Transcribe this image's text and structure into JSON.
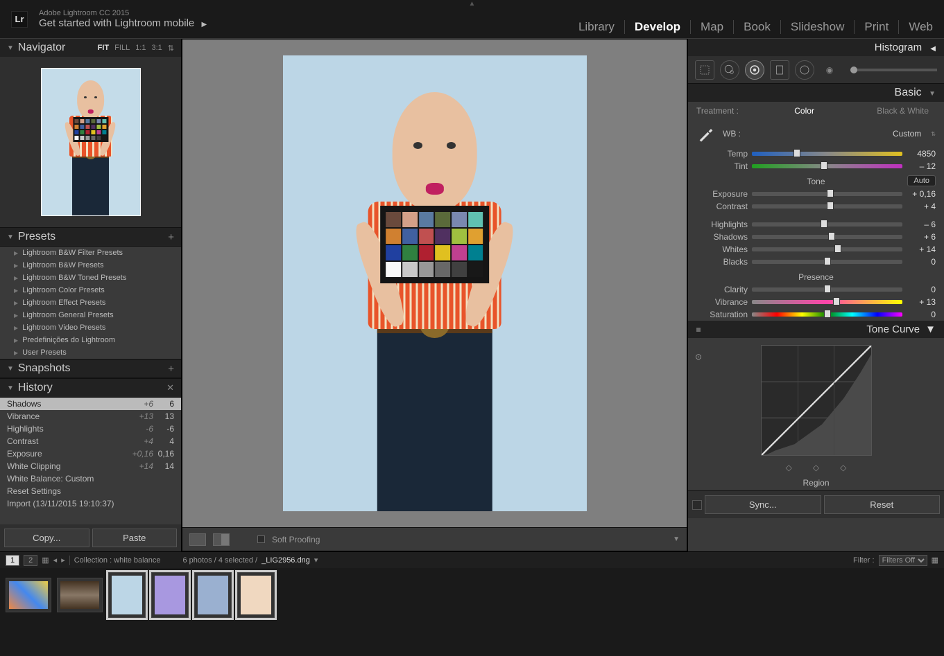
{
  "header": {
    "logo": "Lr",
    "app_title": "Adobe Lightroom CC 2015",
    "subtitle": "Get started with Lightroom mobile",
    "modules": [
      "Library",
      "Develop",
      "Map",
      "Book",
      "Slideshow",
      "Print",
      "Web"
    ],
    "active_module": "Develop"
  },
  "navigator": {
    "title": "Navigator",
    "zoom_levels": [
      "FIT",
      "FILL",
      "1:1",
      "3:1"
    ],
    "zoom_active": "FIT"
  },
  "presets": {
    "title": "Presets",
    "items": [
      "Lightroom B&W Filter Presets",
      "Lightroom B&W Presets",
      "Lightroom B&W Toned Presets",
      "Lightroom Color Presets",
      "Lightroom Effect Presets",
      "Lightroom General Presets",
      "Lightroom Video Presets",
      "Predefinições do Lightroom",
      "User Presets"
    ]
  },
  "snapshots": {
    "title": "Snapshots"
  },
  "history": {
    "title": "History",
    "items": [
      {
        "name": "Shadows",
        "delta": "+6",
        "val": "6",
        "sel": true
      },
      {
        "name": "Vibrance",
        "delta": "+13",
        "val": "13"
      },
      {
        "name": "Highlights",
        "delta": "-6",
        "val": "-6"
      },
      {
        "name": "Contrast",
        "delta": "+4",
        "val": "4"
      },
      {
        "name": "Exposure",
        "delta": "+0,16",
        "val": "0,16"
      },
      {
        "name": "White Clipping",
        "delta": "+14",
        "val": "14"
      },
      {
        "name": "White Balance: Custom",
        "delta": "",
        "val": ""
      },
      {
        "name": "Reset Settings",
        "delta": "",
        "val": ""
      },
      {
        "name": "Import (13/11/2015 19:10:37)",
        "delta": "",
        "val": ""
      }
    ]
  },
  "left_buttons": {
    "copy": "Copy...",
    "paste": "Paste"
  },
  "center_bottom": {
    "soft_proof": "Soft Proofing"
  },
  "right": {
    "histogram": "Histogram",
    "basic": {
      "title": "Basic",
      "treatment_label": "Treatment :",
      "color": "Color",
      "bw": "Black & White",
      "wb_label": "WB :",
      "wb_value": "Custom",
      "tone_label": "Tone",
      "auto": "Auto",
      "presence_label": "Presence",
      "sliders": {
        "temp": {
          "label": "Temp",
          "value": "4850",
          "pos": 30
        },
        "tint": {
          "label": "Tint",
          "value": "– 12",
          "pos": 48
        },
        "exposure": {
          "label": "Exposure",
          "value": "+ 0,16",
          "pos": 52
        },
        "contrast": {
          "label": "Contrast",
          "value": "+ 4",
          "pos": 52
        },
        "highlights": {
          "label": "Highlights",
          "value": "– 6",
          "pos": 48
        },
        "shadows": {
          "label": "Shadows",
          "value": "+ 6",
          "pos": 53
        },
        "whites": {
          "label": "Whites",
          "value": "+ 14",
          "pos": 57
        },
        "blacks": {
          "label": "Blacks",
          "value": "0",
          "pos": 50
        },
        "clarity": {
          "label": "Clarity",
          "value": "0",
          "pos": 50
        },
        "vibrance": {
          "label": "Vibrance",
          "value": "+ 13",
          "pos": 56
        },
        "saturation": {
          "label": "Saturation",
          "value": "0",
          "pos": 50
        }
      }
    },
    "tone_curve": {
      "title": "Tone Curve",
      "region": "Region"
    },
    "buttons": {
      "sync": "Sync...",
      "reset": "Reset"
    }
  },
  "filmstrip_bar": {
    "pages": [
      "1",
      "2"
    ],
    "collection": "Collection : white balance",
    "count": "6 photos / 4 selected /",
    "filename": "_LIG2956.dng",
    "filter_label": "Filter :",
    "filter_value": "Filters Off"
  },
  "checker_colors": [
    "#6a4a3c",
    "#d4a088",
    "#5a7aa0",
    "#5a6a3a",
    "#7a88b0",
    "#60c0b0",
    "#d08030",
    "#4060a0",
    "#c05050",
    "#503060",
    "#a0c040",
    "#e0a030",
    "#2040a0",
    "#308040",
    "#b02030",
    "#e0c020",
    "#c04090",
    "#008090",
    "#f8f8f8",
    "#c8c8c8",
    "#989898",
    "#686868",
    "#404040",
    "#181818"
  ]
}
